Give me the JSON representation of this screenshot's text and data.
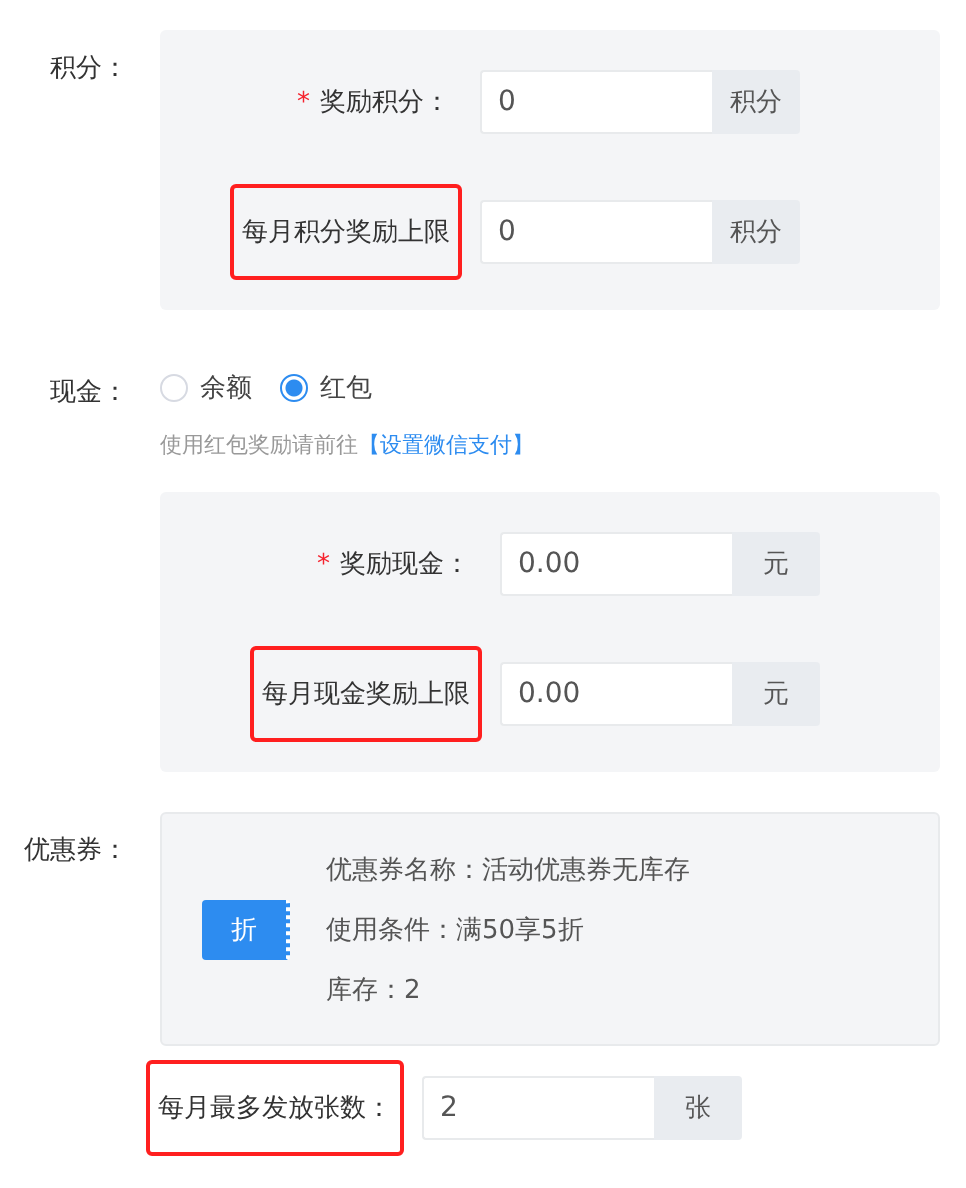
{
  "points": {
    "label": "积分：",
    "fields": [
      {
        "label": "奖励积分：",
        "required_mark": "*",
        "highlighted": false,
        "value": "0",
        "unit": "积分"
      },
      {
        "label": "每月积分奖励上限",
        "highlighted": true,
        "value": "0",
        "unit": "积分"
      }
    ]
  },
  "cash": {
    "label": "现金：",
    "options": [
      {
        "label": "余额",
        "selected": false
      },
      {
        "label": "红包",
        "selected": true
      }
    ],
    "hint": "使用红包奖励请前往",
    "hint_link": "【设置微信支付】",
    "fields": [
      {
        "label": "奖励现金：",
        "required_mark": "*",
        "highlighted": false,
        "value": "0.00",
        "unit": "元"
      },
      {
        "label": "每月现金奖励上限",
        "highlighted": true,
        "value": "0.00",
        "unit": "元"
      }
    ]
  },
  "coupon": {
    "label": "优惠券：",
    "badge": "折",
    "lines": [
      "优惠券名称：活动优惠券无库存",
      "使用条件：满50享5折",
      "库存：2"
    ]
  },
  "monthly_limit": {
    "label": "每月最多发放张数：",
    "highlighted": true,
    "value": "2",
    "unit": "张"
  }
}
